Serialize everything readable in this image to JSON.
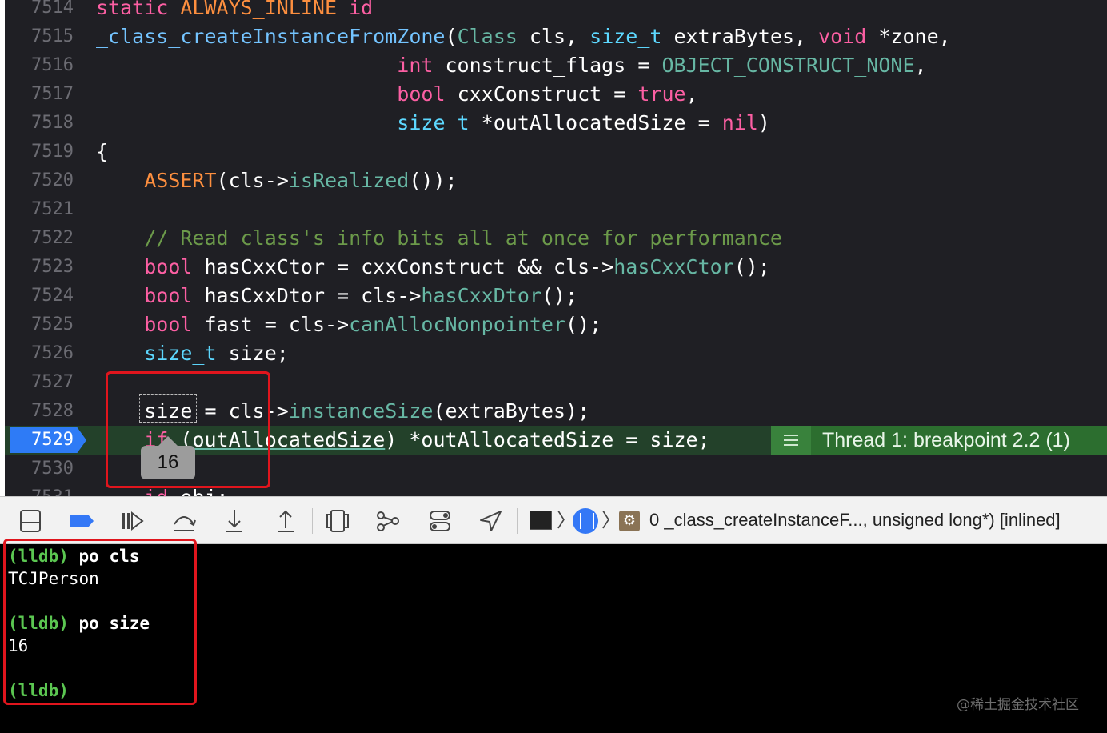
{
  "editor": {
    "lines": [
      {
        "num": "7514",
        "tokens": [
          {
            "t": "static ",
            "c": "kw"
          },
          {
            "t": "ALWAYS_INLINE ",
            "c": "mc"
          },
          {
            "t": "id",
            "c": "kw"
          }
        ]
      },
      {
        "num": "7515",
        "tokens": [
          {
            "t": "_class_createInstanceFromZone",
            "c": "fc"
          },
          {
            "t": "(",
            "c": ""
          },
          {
            "t": "Class",
            "c": "hl"
          },
          {
            "t": " cls, ",
            "c": ""
          },
          {
            "t": "size_t",
            "c": "ty"
          },
          {
            "t": " extraBytes, ",
            "c": ""
          },
          {
            "t": "void",
            "c": "kw"
          },
          {
            "t": " *zone,",
            "c": ""
          }
        ]
      },
      {
        "num": "7516",
        "tokens": [
          {
            "t": "                         ",
            "c": ""
          },
          {
            "t": "int",
            "c": "kw"
          },
          {
            "t": " construct_flags = ",
            "c": ""
          },
          {
            "t": "OBJECT_CONSTRUCT_NONE",
            "c": "hl"
          },
          {
            "t": ",",
            "c": ""
          }
        ]
      },
      {
        "num": "7517",
        "tokens": [
          {
            "t": "                         ",
            "c": ""
          },
          {
            "t": "bool",
            "c": "kw"
          },
          {
            "t": " cxxConstruct = ",
            "c": ""
          },
          {
            "t": "true",
            "c": "kw"
          },
          {
            "t": ",",
            "c": ""
          }
        ]
      },
      {
        "num": "7518",
        "tokens": [
          {
            "t": "                         ",
            "c": ""
          },
          {
            "t": "size_t",
            "c": "ty"
          },
          {
            "t": " *outAllocatedSize = ",
            "c": ""
          },
          {
            "t": "nil",
            "c": "kw"
          },
          {
            "t": ")",
            "c": ""
          }
        ]
      },
      {
        "num": "7519",
        "tokens": [
          {
            "t": "{",
            "c": ""
          }
        ]
      },
      {
        "num": "7520",
        "tokens": [
          {
            "t": "    ",
            "c": ""
          },
          {
            "t": "ASSERT",
            "c": "mc"
          },
          {
            "t": "(cls->",
            "c": ""
          },
          {
            "t": "isRealized",
            "c": "hl"
          },
          {
            "t": "());",
            "c": ""
          }
        ]
      },
      {
        "num": "7521",
        "tokens": []
      },
      {
        "num": "7522",
        "tokens": [
          {
            "t": "    // Read class's info bits all at once for performance",
            "c": "cm"
          }
        ]
      },
      {
        "num": "7523",
        "tokens": [
          {
            "t": "    ",
            "c": ""
          },
          {
            "t": "bool",
            "c": "kw"
          },
          {
            "t": " hasCxxCtor = cxxConstruct && cls->",
            "c": ""
          },
          {
            "t": "hasCxxCtor",
            "c": "hl"
          },
          {
            "t": "();",
            "c": ""
          }
        ]
      },
      {
        "num": "7524",
        "tokens": [
          {
            "t": "    ",
            "c": ""
          },
          {
            "t": "bool",
            "c": "kw"
          },
          {
            "t": " hasCxxDtor = cls->",
            "c": ""
          },
          {
            "t": "hasCxxDtor",
            "c": "hl"
          },
          {
            "t": "();",
            "c": ""
          }
        ]
      },
      {
        "num": "7525",
        "tokens": [
          {
            "t": "    ",
            "c": ""
          },
          {
            "t": "bool",
            "c": "kw"
          },
          {
            "t": " fast = cls->",
            "c": ""
          },
          {
            "t": "canAllocNonpointer",
            "c": "hl"
          },
          {
            "t": "();",
            "c": ""
          }
        ]
      },
      {
        "num": "7526",
        "tokens": [
          {
            "t": "    ",
            "c": ""
          },
          {
            "t": "size_t",
            "c": "ty"
          },
          {
            "t": " size;",
            "c": ""
          }
        ]
      },
      {
        "num": "7527",
        "tokens": []
      },
      {
        "num": "7528",
        "tokens": [
          {
            "t": "    size = cls->",
            "c": ""
          },
          {
            "t": "instanceSize",
            "c": "hl"
          },
          {
            "t": "(extraBytes);",
            "c": ""
          }
        ]
      },
      {
        "num": "7529",
        "tokens": [
          {
            "t": "    ",
            "c": ""
          },
          {
            "t": "if",
            "c": "kw"
          },
          {
            "t": " (",
            "c": ""
          },
          {
            "t": "outAllocatedSize",
            "c": "ul"
          },
          {
            "t": ") *outAllocatedSize = size;",
            "c": ""
          }
        ]
      },
      {
        "num": "7530",
        "tokens": []
      },
      {
        "num": "7531",
        "tokens": [
          {
            "t": "    ",
            "c": ""
          },
          {
            "t": "id",
            "c": "kw"
          },
          {
            "t": " obj;",
            "c": ""
          }
        ]
      }
    ],
    "current_line": "7529",
    "thread_badge": "Thread 1: breakpoint 2.2 (1)",
    "tooltip_value": "16"
  },
  "toolbar": {
    "buttons": [
      {
        "name": "hide-debug-area-button",
        "icon": "panel-bottom-icon"
      },
      {
        "name": "breakpoints-toggle-button",
        "icon": "breakpoint-icon"
      },
      {
        "name": "continue-button",
        "icon": "continue-icon"
      },
      {
        "name": "step-over-button",
        "icon": "step-over-icon"
      },
      {
        "name": "step-into-button",
        "icon": "step-into-icon"
      },
      {
        "name": "step-out-button",
        "icon": "step-out-icon"
      },
      {
        "name": "debug-view-hierarchy-button",
        "icon": "view-hierarchy-icon"
      },
      {
        "name": "debug-memory-graph-button",
        "icon": "memory-graph-icon"
      },
      {
        "name": "environment-overrides-button",
        "icon": "toggles-icon"
      },
      {
        "name": "simulate-location-button",
        "icon": "location-icon"
      }
    ],
    "breadcrumb_frame": "0 _class_createInstanceF..., unsigned long*) [inlined]",
    "accent": "#3478f6"
  },
  "console": {
    "entries": [
      {
        "prompt": "(lldb)",
        "command": "po cls",
        "output": "TCJPerson"
      },
      {
        "prompt": "(lldb)",
        "command": "po size",
        "output": "16"
      },
      {
        "prompt": "(lldb)",
        "command": "",
        "output": ""
      }
    ]
  },
  "watermark": "@稀土掘金技术社区"
}
